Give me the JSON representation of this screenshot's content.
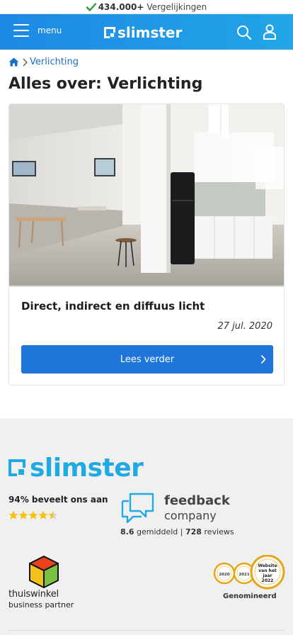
{
  "topbar": {
    "count": "434.000+",
    "label": "Vergelijkingen"
  },
  "header": {
    "menu_label": "menu",
    "logo_text": "slimster",
    "search_icon": "search-icon",
    "user_icon": "user-icon"
  },
  "breadcrumb": {
    "current": "Verlichting"
  },
  "page_title": "Alles over: Verlichting",
  "article": {
    "title": "Direct, indirect en diffuus licht",
    "date": "27 jul. 2020",
    "button_label": "Lees verder"
  },
  "footer": {
    "logo_text": "slimster",
    "recommend": "94% beveelt ons aan",
    "rating_stars": 4.5,
    "feedback_word1": "feedback",
    "feedback_word2": "company",
    "score": "8.6",
    "score_label": "gemiddeld |",
    "reviews_count": "728",
    "reviews_label": "reviews",
    "thuiswinkel_name": "thuiswinkel",
    "thuiswinkel_sub": "business partner",
    "award_years": [
      "2020",
      "2021"
    ],
    "award_third": "Website van het jaar 2022",
    "award_label": "Genomineerd"
  },
  "colors": {
    "header_start": "#1d88e5",
    "header_end": "#22a6e6",
    "button": "#1f75d9",
    "link": "#1a6fc9",
    "logo": "#21a9e1",
    "star": "#f4c20d",
    "gold": "#e6a519"
  }
}
